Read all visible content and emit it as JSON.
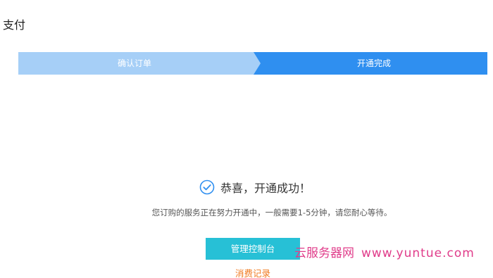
{
  "page": {
    "title": "支付"
  },
  "steps": [
    {
      "label": "确认订单",
      "state": "done",
      "color": "#a6cff7"
    },
    {
      "label": "开通完成",
      "state": "active",
      "color": "#2f8ff0"
    }
  ],
  "result": {
    "icon": "check-circle-icon",
    "message": "恭喜，开通成功！",
    "notice": "您订购的服务正在努力开通中，一般需要1-5分钟，请您耐心等待。"
  },
  "actions": {
    "console_label": "管理控制台",
    "records_label": "消费记录"
  },
  "watermark": {
    "brand": "云服务器网",
    "url": "www.yuntue.com"
  },
  "colors": {
    "accent": "#2f8ff0",
    "button": "#27c0d6",
    "link": "#f07a1f"
  }
}
